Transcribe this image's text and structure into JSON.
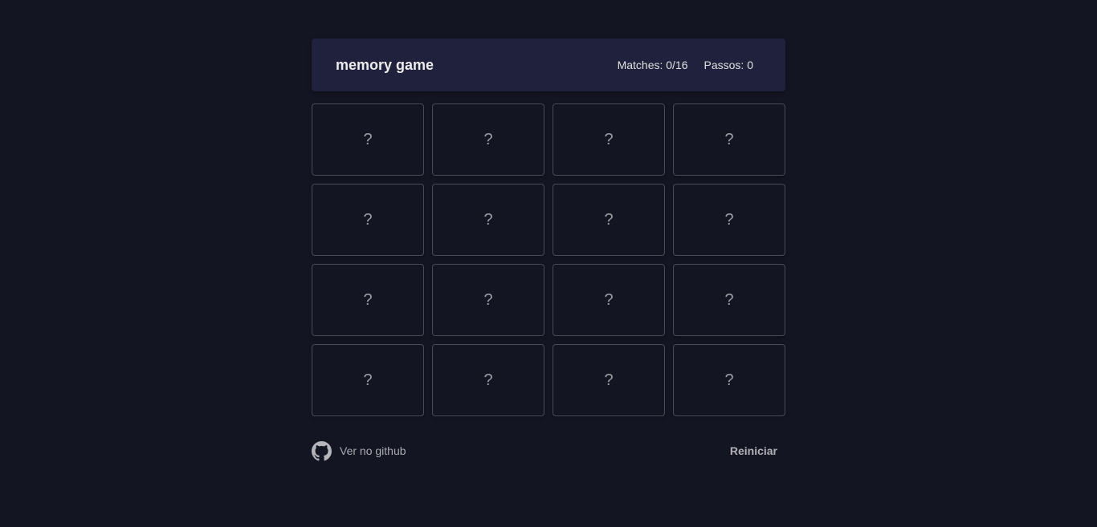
{
  "header": {
    "title": "memory game",
    "matches_label": "Matches: 0/16",
    "steps_label": "Passos: 0"
  },
  "game": {
    "matches": 0,
    "total_matches": 16,
    "steps": 0
  },
  "cards": [
    {
      "face": "?"
    },
    {
      "face": "?"
    },
    {
      "face": "?"
    },
    {
      "face": "?"
    },
    {
      "face": "?"
    },
    {
      "face": "?"
    },
    {
      "face": "?"
    },
    {
      "face": "?"
    },
    {
      "face": "?"
    },
    {
      "face": "?"
    },
    {
      "face": "?"
    },
    {
      "face": "?"
    },
    {
      "face": "?"
    },
    {
      "face": "?"
    },
    {
      "face": "?"
    },
    {
      "face": "?"
    }
  ],
  "footer": {
    "github_label": "Ver no github",
    "github_icon": "github-icon",
    "restart_label": "Reiniciar"
  },
  "colors": {
    "background": "#141522",
    "header_background": "#20213c",
    "card_border": "#4a4b57"
  }
}
